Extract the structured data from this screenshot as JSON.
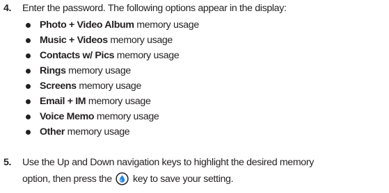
{
  "step4": {
    "number": "4.",
    "text": "Enter the password. The following options appear in the display:"
  },
  "options": [
    {
      "name": "Photo + Video Album",
      "suffix": " memory usage"
    },
    {
      "name": "Music + Videos",
      "suffix": " memory usage"
    },
    {
      "name": "Contacts w/ Pics",
      "suffix": " memory usage"
    },
    {
      "name": "Rings",
      "suffix": " memory usage"
    },
    {
      "name": "Screens",
      "suffix": " memory usage"
    },
    {
      "name": "Email + IM",
      "suffix": " memory usage"
    },
    {
      "name": "Voice Memo",
      "suffix": " memory usage"
    },
    {
      "name": "Other",
      "suffix": " memory usage"
    }
  ],
  "step5": {
    "number": "5.",
    "line1": "Use the Up and Down navigation keys to highlight the desired memory",
    "line2_before": "option, then press the",
    "line2_after": "key to save your setting.",
    "key_icon": "ok-key-icon"
  },
  "colors": {
    "text": "#231f20",
    "key_fill": "#1e88e5"
  }
}
